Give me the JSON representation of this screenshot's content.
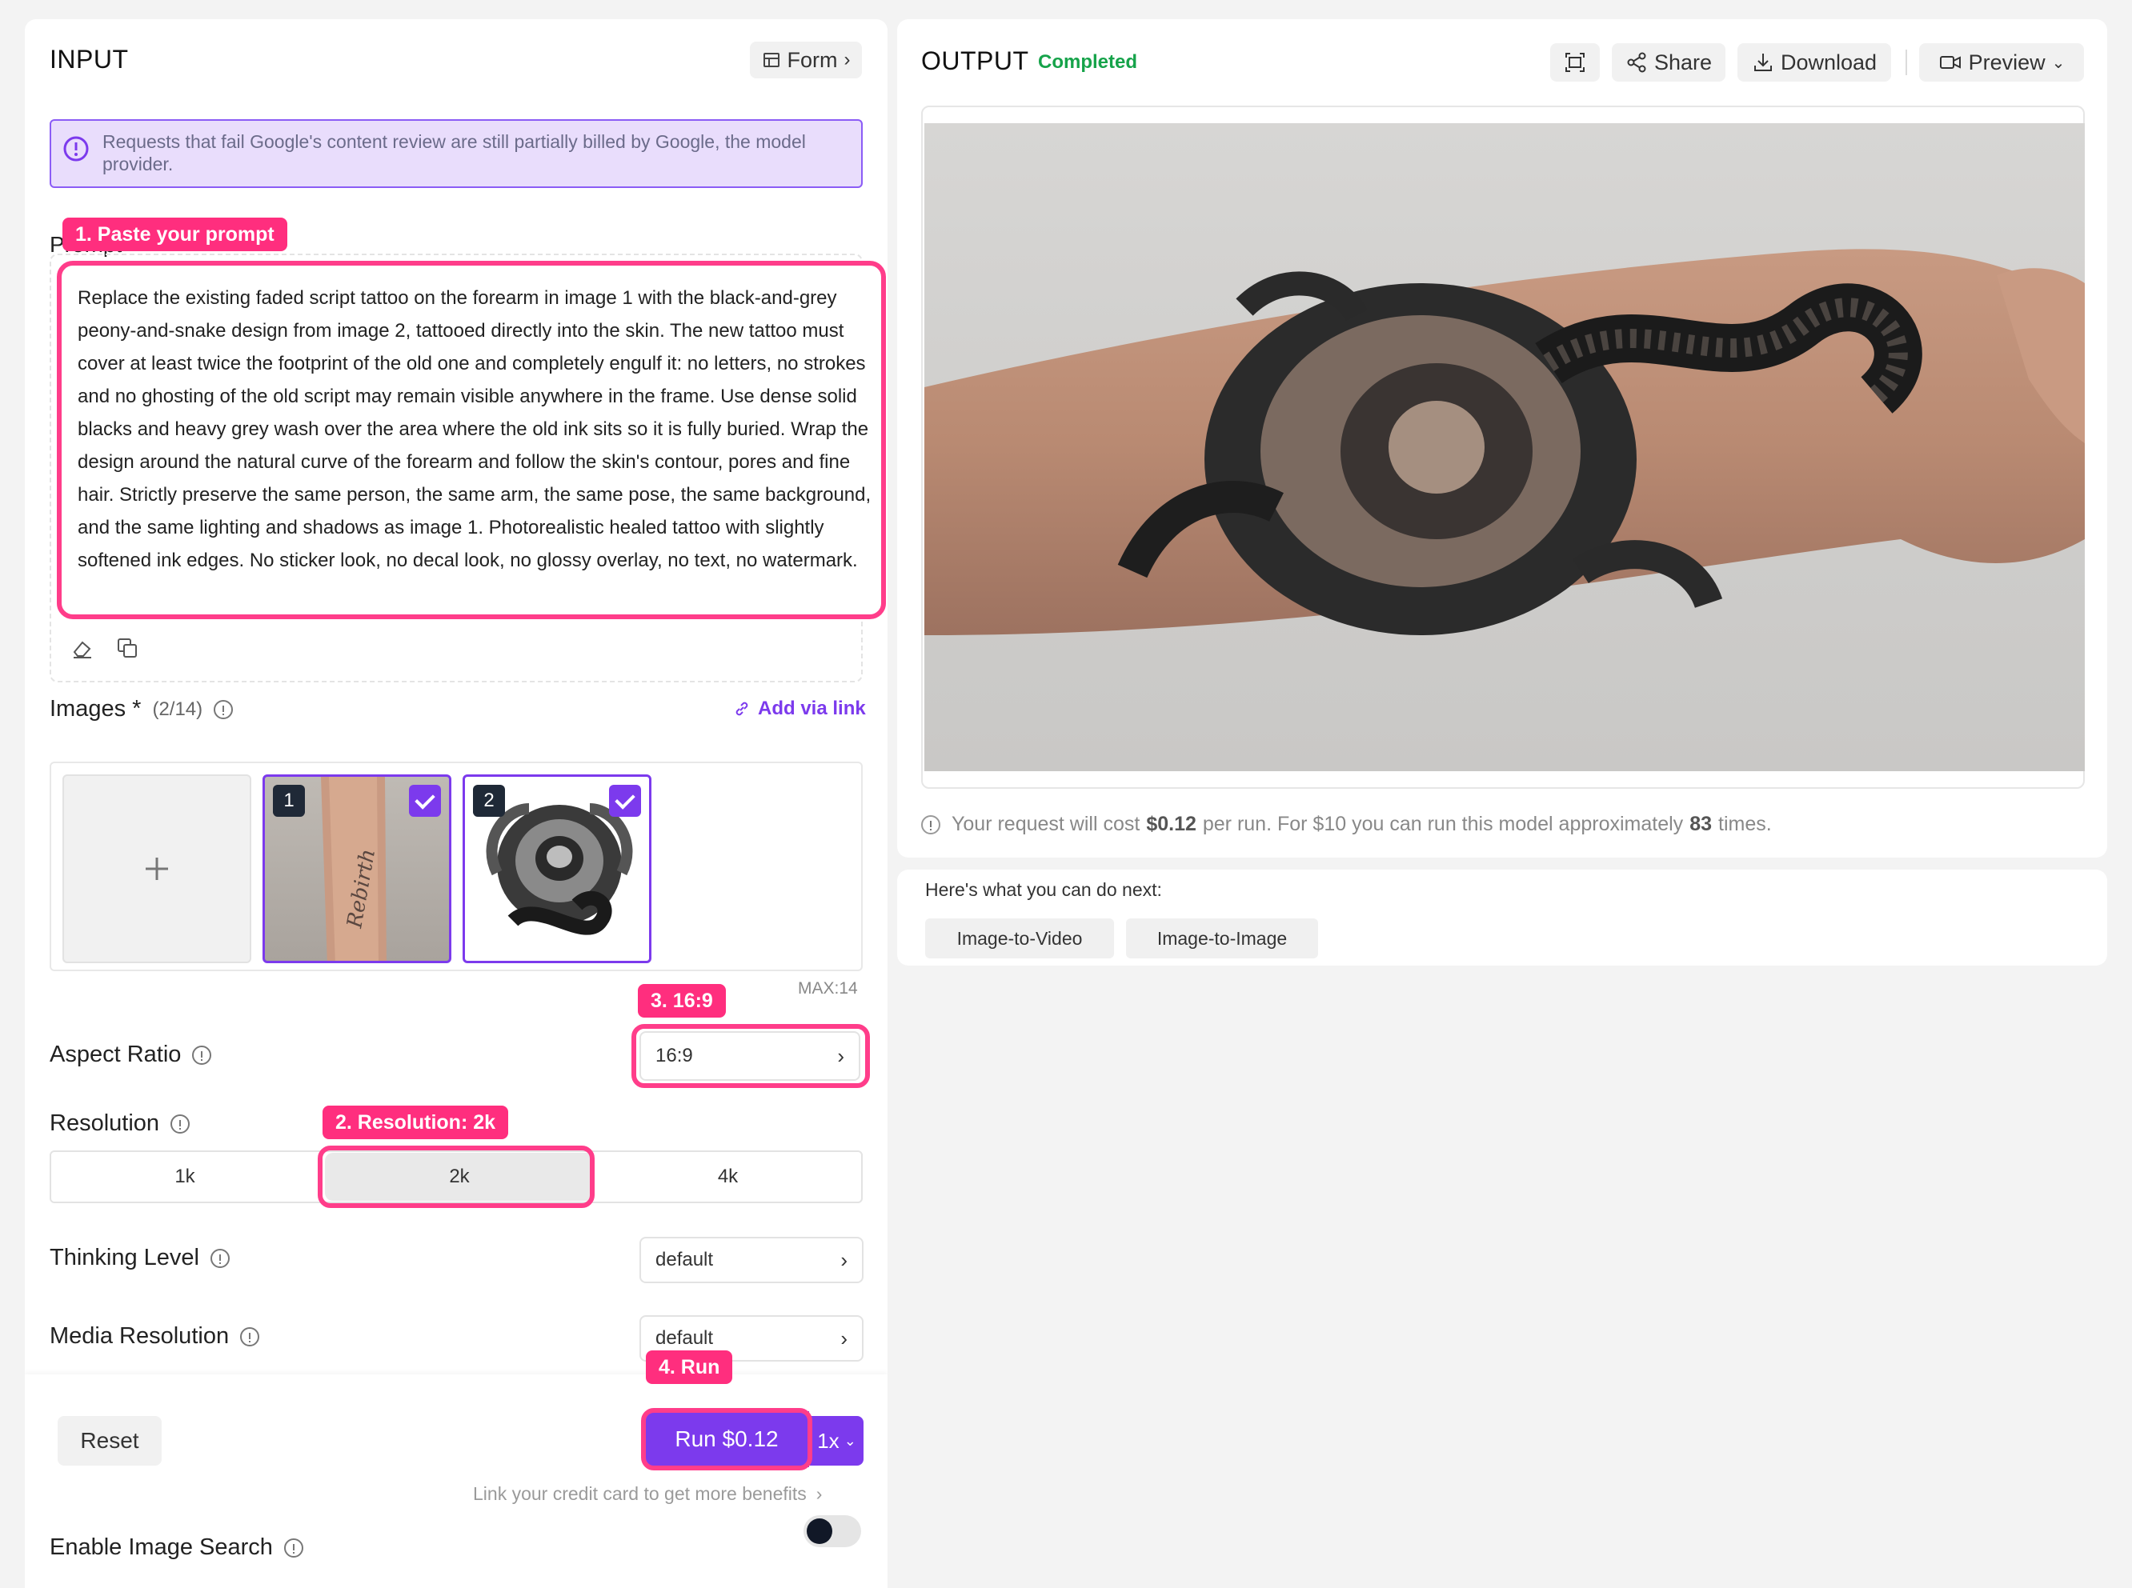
{
  "input": {
    "title": "INPUT",
    "form_label": "Form",
    "notice": "Requests that fail Google's content review are still partially billed by Google, the model provider.",
    "prompt_label": "Prompt",
    "prompt_text": "Replace the existing faded script tattoo on the forearm in image 1 with the black-and-grey peony-and-snake design from image 2, tattooed directly into the skin. The new tattoo must cover at least twice the footprint of the old one and completely engulf it: no letters, no strokes and no ghosting of the old script may remain visible anywhere in the frame. Use dense solid blacks and heavy grey wash over the area where the old ink sits so it is fully buried. Wrap the design around the natural curve of the forearm and follow the skin's contour, pores and fine hair. Strictly preserve the same person, the same arm, the same pose, the same background, and the same lighting and shadows as image 1. Photorealistic healed tattoo with slightly softened ink edges. No sticker look, no decal look, no glossy overlay, no text, no watermark.",
    "images_label": "Images *",
    "images_count": "(2/14)",
    "add_via_link": "Add via link",
    "image_1_num": "1",
    "image_2_num": "2",
    "max_label": "MAX:14",
    "aspect_label": "Aspect Ratio",
    "aspect_value": "16:9",
    "resolution_label": "Resolution",
    "resolution_options": [
      "1k",
      "2k",
      "4k"
    ],
    "resolution_selected": "2k",
    "thinking_label": "Thinking Level",
    "thinking_value": "default",
    "media_label": "Media Resolution",
    "media_value": "default",
    "reset_label": "Reset",
    "run_label": "Run $0.12",
    "multiplier": "1x",
    "credit_link": "Link your credit card to get more benefits",
    "image_search_label": "Enable Image Search",
    "image_search_enabled": false
  },
  "annotations": {
    "step1": "1. Paste your prompt",
    "step2": "2. Resolution: 2k",
    "step3": "3. 16:9",
    "step4": "4. Run"
  },
  "output": {
    "title": "OUTPUT",
    "status": "Completed",
    "share_label": "Share",
    "download_label": "Download",
    "preview_label": "Preview",
    "cost_prefix": "Your request will cost",
    "cost_value": "$0.12",
    "cost_mid": "per run. For $10 you can run this model approximately",
    "cost_times": "83",
    "cost_suffix": "times."
  },
  "next": {
    "title": "Here's what you can do next:",
    "actions": [
      "Image-to-Video",
      "Image-to-Image"
    ]
  },
  "colors": {
    "accent": "#7c3aed",
    "annotation": "#ff2e7e",
    "completed": "#16a34a",
    "notice_bg": "#e9ddfc"
  },
  "icons": [
    "form-icon",
    "info-icon",
    "eraser-icon",
    "copy-icon",
    "link-icon",
    "plus-icon",
    "check-icon",
    "fullscreen-icon",
    "share-icon",
    "download-icon",
    "video-icon",
    "chevron-down-icon",
    "chevron-right-icon"
  ]
}
